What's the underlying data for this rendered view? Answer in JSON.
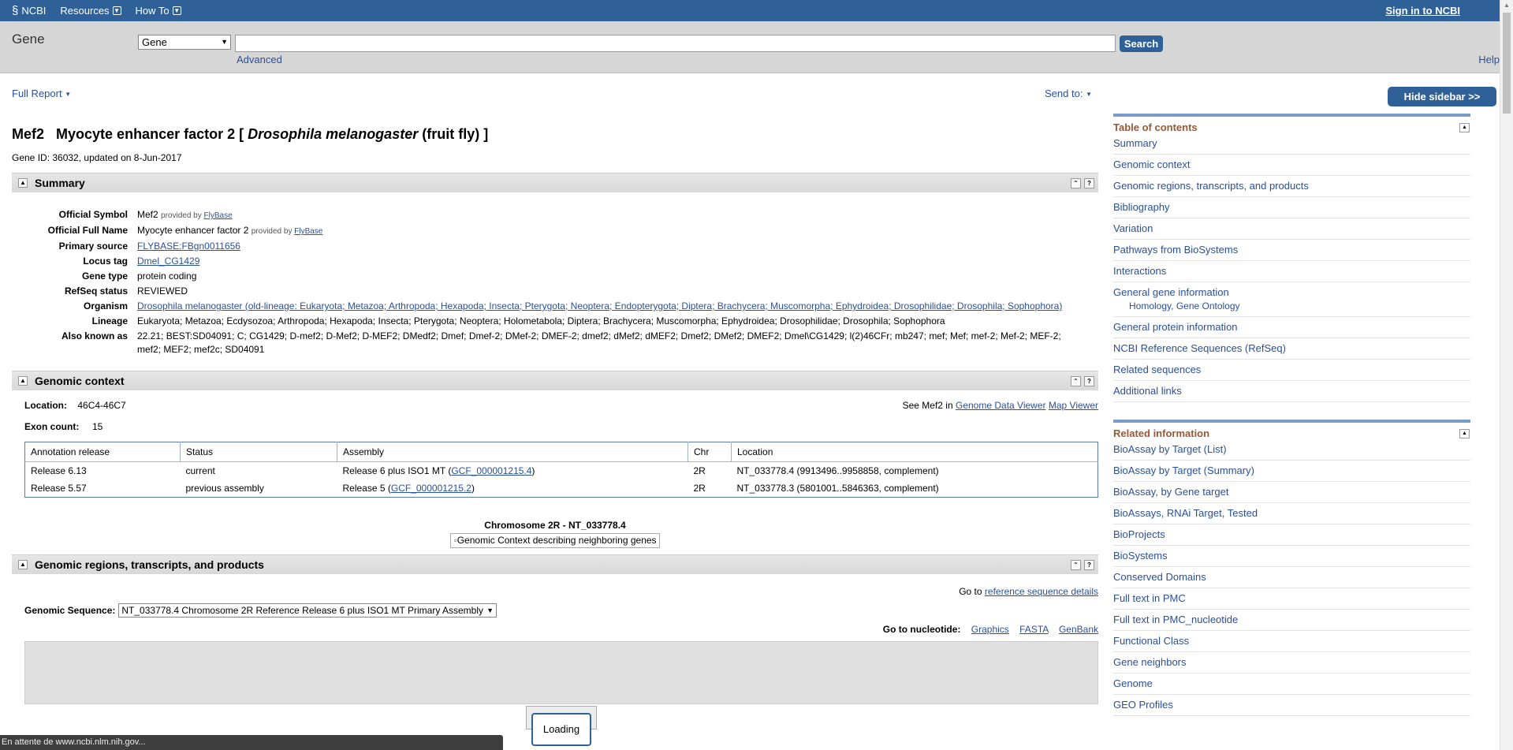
{
  "topbar": {
    "logo": "NCBI",
    "resources": "Resources",
    "howto": "How To",
    "signin": "Sign in to NCBI"
  },
  "search": {
    "db_title": "Gene",
    "db_selected": "Gene",
    "query_value": "",
    "button": "Search",
    "advanced": "Advanced",
    "help": "Help"
  },
  "report": {
    "format": "Full Report",
    "send_to": "Send to:",
    "hide_sidebar": "Hide sidebar >>"
  },
  "gene": {
    "symbol": "Mef2",
    "full_name": "Myocyte enhancer factor 2",
    "bracket_open": "[",
    "organism_italic": "Drosophila melanogaster",
    "organism_common": "(fruit fly)",
    "bracket_close": "]",
    "id_line": "Gene ID: 36032, updated on 8-Jun-2017"
  },
  "summary": {
    "heading": "Summary",
    "official_symbol_label": "Official Symbol",
    "official_symbol": "Mef2",
    "official_full_name_label": "Official Full Name",
    "official_full_name": "Myocyte enhancer factor 2",
    "provided_by": "provided by",
    "flybase": "FlyBase",
    "primary_source_label": "Primary source",
    "primary_source": "FLYBASE:FBgn0011656",
    "locus_tag_label": "Locus tag",
    "locus_tag": "Dmel_CG1429",
    "gene_type_label": "Gene type",
    "gene_type": "protein coding",
    "refseq_status_label": "RefSeq status",
    "refseq_status": "REVIEWED",
    "organism_label": "Organism",
    "organism": "Drosophila melanogaster (old-lineage: Eukaryota; Metazoa; Arthropoda; Hexapoda; Insecta; Pterygota; Neoptera; Endopterygota; Diptera; Brachycera; Muscomorpha; Ephydroidea; Drosophilidae; Drosophila; Sophophora)",
    "lineage_label": "Lineage",
    "lineage": "Eukaryota; Metazoa; Ecdysozoa; Arthropoda; Hexapoda; Insecta; Pterygota; Neoptera; Holometabola; Diptera; Brachycera; Muscomorpha; Ephydroidea; Drosophilidae; Drosophila; Sophophora",
    "aka_label": "Also known as",
    "aka": "22.21; BEST:SD04091; C; CG1429; D-mef2; D-Mef2; D-MEF2; DMedf2; Dmef; Dmef-2; DMef-2; DMEF-2; dmef2; dMef2; dMEF2; Dmef2; DMef2; DMEF2; Dmel\\CG1429; l(2)46CFr; mb247; mef; Mef; mef-2; Mef-2; MEF-2; mef2; MEF2; mef2c; SD04091"
  },
  "context": {
    "heading": "Genomic context",
    "location_label": "Location:",
    "location": "46C4-46C7",
    "exon_label": "Exon count:",
    "exon_count": "15",
    "see_prefix": "See Mef2 in",
    "genome_data_viewer": "Genome Data Viewer",
    "map_viewer": "Map Viewer",
    "columns": [
      "Annotation release",
      "Status",
      "Assembly",
      "Chr",
      "Location"
    ],
    "rows": [
      {
        "release": "Release 6.13",
        "status": "current",
        "assembly_prefix": "Release 6 plus ISO1 MT (",
        "assembly_link": "GCF_000001215.4",
        "assembly_suffix": ")",
        "chr": "2R",
        "location": "NT_033778.4 (9913496..9958858, complement)"
      },
      {
        "release": "Release 5.57",
        "status": "previous assembly",
        "assembly_prefix": "Release 5 (",
        "assembly_link": "GCF_000001215.2",
        "assembly_suffix": ")",
        "chr": "2R",
        "location": "NT_033778.3 (5801001..5846363, complement)"
      }
    ],
    "chromosome_title": "Chromosome 2R - NT_033778.4",
    "image_alt": "Genomic Context describing neighboring genes"
  },
  "regions": {
    "heading": "Genomic regions, transcripts, and products",
    "goto_prefix": "Go to",
    "goto_link": "reference sequence details",
    "seq_label": "Genomic Sequence:",
    "seq_selected": "NT_033778.4 Chromosome 2R Reference Release 6 plus ISO1 MT Primary Assembly",
    "nucleotide_label": "Go to nucleotide:",
    "graphics": "Graphics",
    "fasta": "FASTA",
    "genbank": "GenBank",
    "loading": "Loading"
  },
  "sidebar": {
    "toc_title": "Table of contents",
    "toc": [
      "Summary",
      "Genomic context",
      "Genomic regions, transcripts, and products",
      "Bibliography",
      "Variation",
      "Pathways from BioSystems",
      "Interactions",
      "General gene information",
      "General protein information",
      "NCBI Reference Sequences (RefSeq)",
      "Related sequences",
      "Additional links"
    ],
    "toc_sub": [
      "Homology,",
      "Gene Ontology"
    ],
    "related_title": "Related information",
    "related": [
      "BioAssay by Target (List)",
      "BioAssay by Target (Summary)",
      "BioAssay, by Gene target",
      "BioAssays, RNAi Target, Tested",
      "BioProjects",
      "BioSystems",
      "Conserved Domains",
      "Full text in PMC",
      "Full text in PMC_nucleotide",
      "Functional Class",
      "Gene neighbors",
      "Genome",
      "GEO Profiles"
    ]
  },
  "status": {
    "text": "En attente de www.ncbi.nlm.nih.gov..."
  },
  "colors": {
    "brand": "#2f6097",
    "link": "#2a5099",
    "sidebar_title": "#985735"
  }
}
